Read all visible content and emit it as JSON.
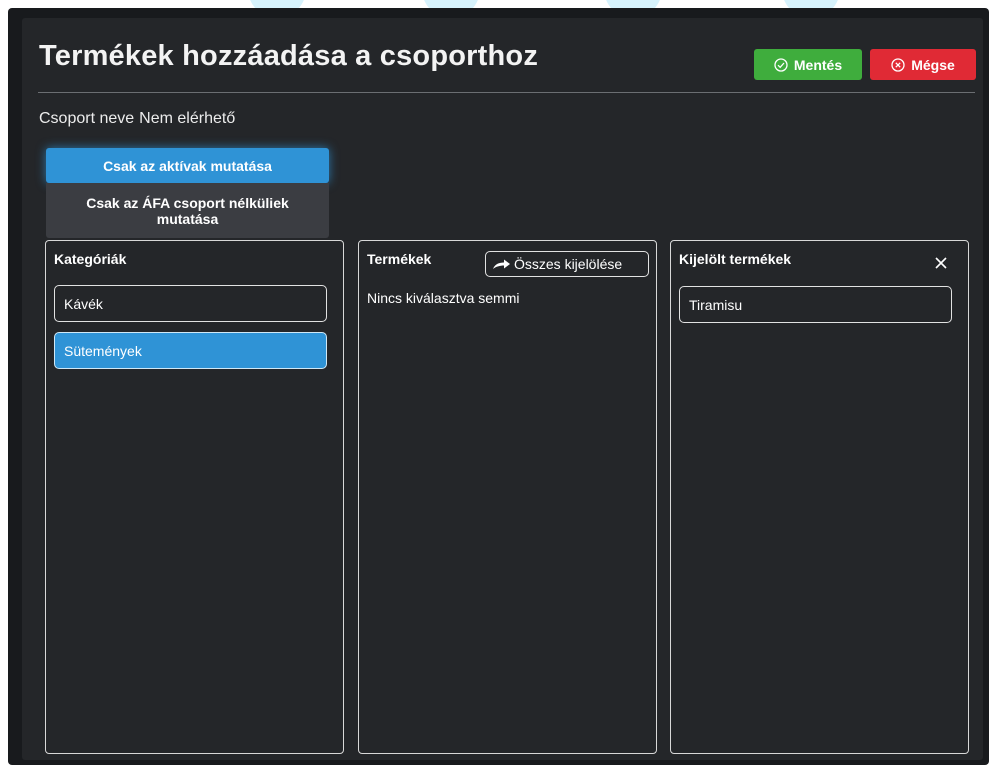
{
  "header": {
    "title": "Termékek hozzáadása a csoporthoz",
    "save_label": "Mentés",
    "cancel_label": "Mégse"
  },
  "group": {
    "label": "Csoport neve",
    "value": "Nem elérhető"
  },
  "filters": {
    "active_only": "Csak az aktívak mutatása",
    "no_vat_group": "Csak az ÁFA csoport nélküliek mutatása"
  },
  "categories": {
    "title": "Kategóriák",
    "items": [
      {
        "label": "Kávék",
        "selected": false
      },
      {
        "label": "Sütemények",
        "selected": true
      }
    ]
  },
  "products": {
    "title": "Termékek",
    "select_all_label": "Összes kijelölése",
    "empty_text": "Nincs kiválasztva semmi"
  },
  "selected_products": {
    "title": "Kijelölt termékek",
    "items": [
      {
        "label": "Tiramisu"
      }
    ]
  },
  "icons": {
    "save": "check-circle-icon",
    "cancel": "x-circle-icon",
    "select_all": "share-arrow-icon",
    "clear_selected": "close-icon"
  },
  "colors": {
    "background": "#181a1d",
    "panel": "#242629",
    "accent_blue": "#2f93d6",
    "save_green": "#3fad3d",
    "cancel_red": "#e02a35"
  }
}
